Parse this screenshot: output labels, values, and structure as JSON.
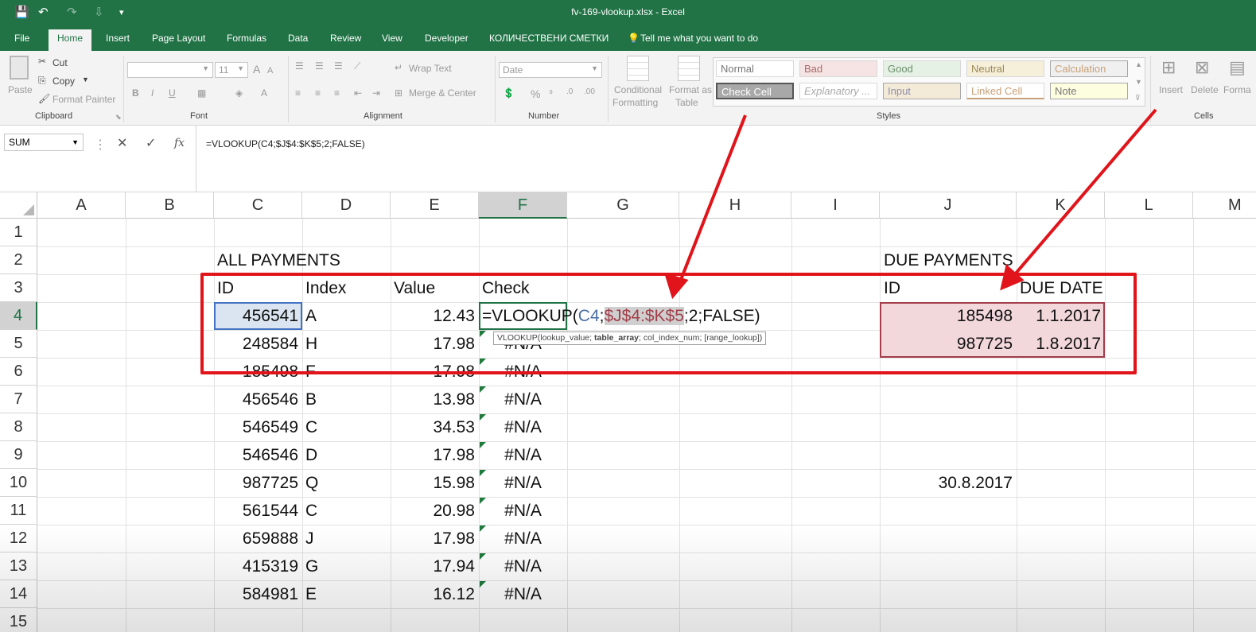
{
  "title": "fv-169-vlookup.xlsx - Excel",
  "qat": {
    "save": "💾",
    "undo": "↶",
    "redo": "↷",
    "more": "⇩",
    "customize": "▾"
  },
  "tabs": [
    "File",
    "Home",
    "Insert",
    "Page Layout",
    "Formulas",
    "Data",
    "Review",
    "View",
    "Developer",
    "КОЛИЧЕСТВЕНИ СМЕТКИ",
    "Tell me what you want to do"
  ],
  "ribbon": {
    "clipboard": {
      "paste": "Paste",
      "cut": "Cut",
      "copy": "Copy",
      "format_painter": "Format Painter",
      "label": "Clipboard"
    },
    "font": {
      "size": "11",
      "label": "Font",
      "bold": "B",
      "italic": "I",
      "underline": "U"
    },
    "alignment": {
      "wrap": "Wrap Text",
      "merge": "Merge & Center",
      "label": "Alignment"
    },
    "number": {
      "format": "Date",
      "label": "Number",
      "percent": "%"
    },
    "cond": {
      "l1": "Conditional",
      "l2": "Formatting"
    },
    "fmt_table": {
      "l1": "Format as",
      "l2": "Table"
    },
    "styles": {
      "label": "Styles",
      "items": [
        "Normal",
        "Bad",
        "Good",
        "Neutral",
        "Calculation",
        "Check Cell",
        "Explanatory ...",
        "Input",
        "Linked Cell",
        "Note"
      ]
    },
    "cells": {
      "insert": "Insert",
      "delete": "Delete",
      "format": "Forma",
      "label": "Cells"
    }
  },
  "formula_bar": {
    "name_box": "SUM",
    "cancel": "✕",
    "enter": "✓",
    "fx": "fx",
    "formula": "=VLOOKUP(C4;$J$4:$K$5;2;FALSE)"
  },
  "columns": [
    "A",
    "B",
    "C",
    "D",
    "E",
    "F",
    "G",
    "H",
    "I",
    "J",
    "K",
    "L",
    "M"
  ],
  "rows": [
    "1",
    "2",
    "3",
    "4",
    "5",
    "6",
    "7",
    "8",
    "9",
    "10",
    "11",
    "12",
    "13",
    "14",
    "15"
  ],
  "sheet": {
    "all_payments": "ALL PAYMENTS",
    "due_payments": "DUE PAYMENTS",
    "hdr_id": "ID",
    "hdr_index": "Index",
    "hdr_value": "Value",
    "hdr_check": "Check",
    "hdr_id2": "ID",
    "hdr_due": "DUE DATE",
    "editing": {
      "prefix": "=VLOOKUP(",
      "arg1": "C4",
      "sep": ";",
      "arg2": "$J$4:$K$5",
      "rest": ";2;FALSE)"
    },
    "tooltip": {
      "a": "VLOOKUP(lookup_value; ",
      "b": "table_array",
      "c": "; col_index_num; [range_lookup])"
    },
    "data": [
      {
        "id": "456541",
        "index": "A",
        "value": "12.43",
        "check": ""
      },
      {
        "id": "248584",
        "index": "H",
        "value": "17.98",
        "check": "#N/A"
      },
      {
        "id": "185498",
        "index": "F",
        "value": "17.98",
        "check": "#N/A"
      },
      {
        "id": "456546",
        "index": "B",
        "value": "13.98",
        "check": "#N/A"
      },
      {
        "id": "546549",
        "index": "C",
        "value": "34.53",
        "check": "#N/A"
      },
      {
        "id": "546546",
        "index": "D",
        "value": "17.98",
        "check": "#N/A"
      },
      {
        "id": "987725",
        "index": "Q",
        "value": "15.98",
        "check": "#N/A"
      },
      {
        "id": "561544",
        "index": "C",
        "value": "20.98",
        "check": "#N/A"
      },
      {
        "id": "659888",
        "index": "J",
        "value": "17.98",
        "check": "#N/A"
      },
      {
        "id": "415319",
        "index": "G",
        "value": "17.94",
        "check": "#N/A"
      },
      {
        "id": "584981",
        "index": "E",
        "value": "16.12",
        "check": "#N/A"
      }
    ],
    "due": [
      {
        "id": "185498",
        "date": "1.1.2017"
      },
      {
        "id": "987725",
        "date": "1.8.2017"
      }
    ],
    "j10": "30.8.2017"
  },
  "colors": {
    "excel_green": "#217346",
    "annotation_red": "#e0141a",
    "range_fill": "#f2d7db"
  }
}
